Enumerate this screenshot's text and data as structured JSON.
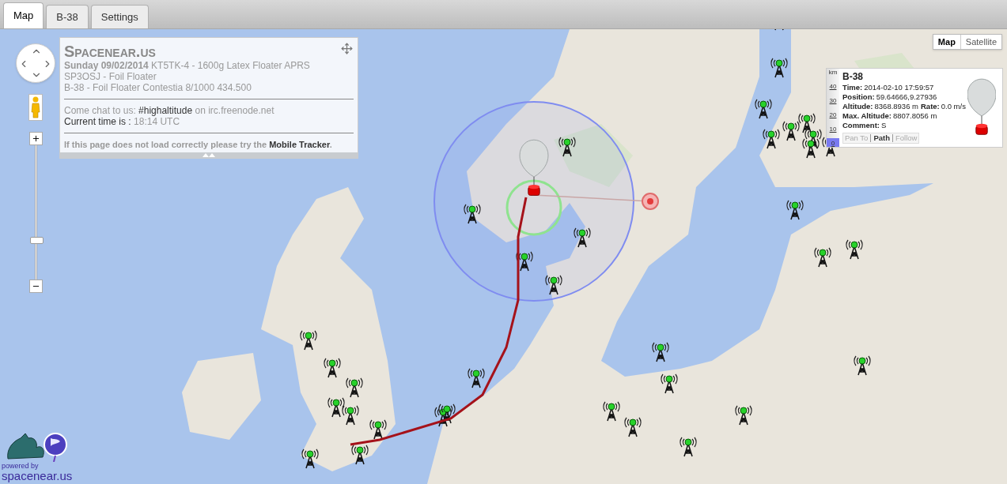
{
  "tabs": [
    {
      "label": "Map",
      "selected": true
    },
    {
      "label": "B-38",
      "selected": false
    },
    {
      "label": "Settings",
      "selected": false
    }
  ],
  "map_type": [
    {
      "label": "Map",
      "selected": true
    },
    {
      "label": "Satellite",
      "selected": false
    }
  ],
  "zoom": {
    "level": 0.28
  },
  "info_panel": {
    "title": "Spacenear.us",
    "lines": [
      "**Sunday 09/02/2014** KT5TK-4 - 1600g Latex Floater APRS",
      "SP3OSJ - Foil Floater",
      "B-38 - Foil Floater Contestia 8/1000 434.500"
    ],
    "chat": {
      "prefix": "Come chat to us:",
      "channel": "#highaltitude",
      "suffix": "on irc.freenode.net"
    },
    "time_label": "Current time is :",
    "time_value": "18:14 UTC",
    "footer": "If this page does not load correctly please try the",
    "footer_link": "Mobile Tracker",
    "footer_end": "."
  },
  "popup": {
    "title": "B-38",
    "scale_unit": "km",
    "scale_ticks": [
      "40",
      "30",
      "20",
      "10",
      "0"
    ],
    "level": 0.11,
    "rows": [
      [
        {
          "label": "Time:",
          "value": "2014-02-10 17:59:57"
        }
      ],
      [
        {
          "label": "Position:",
          "value": "59.64666,9.27936"
        }
      ],
      [
        {
          "label": "Altitude:",
          "value": "8368.8936 m"
        },
        {
          "label": "Rate:",
          "value": "0.0 m/s"
        }
      ],
      [
        {
          "label": "Max. Altitude:",
          "value": "8807.8056 m"
        }
      ],
      [
        {
          "label": "Comment:",
          "value": "S"
        }
      ]
    ],
    "buttons": [
      {
        "label": "Pan To",
        "selected": false
      },
      {
        "label": "Path",
        "selected": true
      },
      {
        "label": "Follow",
        "selected": false
      }
    ]
  },
  "logo": {
    "caption": "powered by",
    "name": "spacenear.us"
  }
}
